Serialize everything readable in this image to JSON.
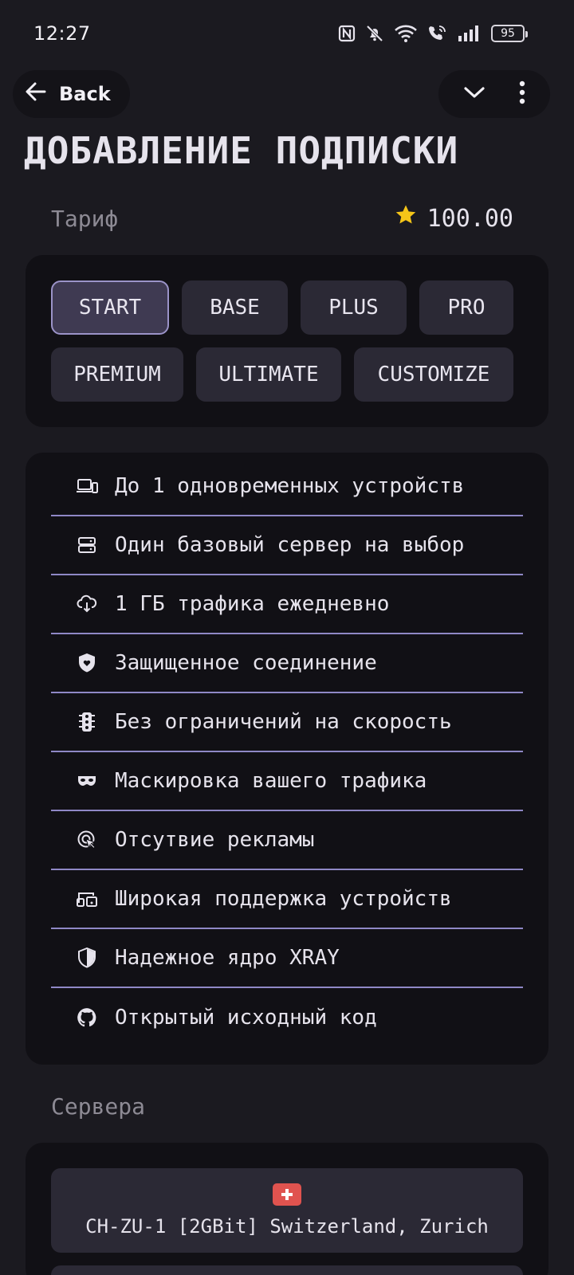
{
  "status_bar": {
    "time": "12:27",
    "battery": "95"
  },
  "header": {
    "back_label": "Back"
  },
  "page": {
    "title": "ДОБАВЛЕНИЕ ПОДПИСКИ"
  },
  "tariff": {
    "label": "Тариф",
    "price": "100.00"
  },
  "plans": {
    "row1": [
      {
        "label": "START",
        "selected": true
      },
      {
        "label": "BASE"
      },
      {
        "label": "PLUS"
      },
      {
        "label": "PRO"
      }
    ],
    "row2": [
      {
        "label": "PREMIUM"
      },
      {
        "label": "ULTIMATE"
      },
      {
        "label": "CUSTOMIZE"
      }
    ]
  },
  "features": [
    {
      "icon": "devices-icon",
      "text": "До 1 одновременных устройств"
    },
    {
      "icon": "server-icon",
      "text": "Один базовый сервер на выбор"
    },
    {
      "icon": "cloud-download-icon",
      "text": "1 ГБ трафика ежедневно"
    },
    {
      "icon": "shield-heart-icon",
      "text": "Защищенное соединение"
    },
    {
      "icon": "traffic-light-icon",
      "text": "Без ограничений на скорость"
    },
    {
      "icon": "mask-icon",
      "text": "Маскировка вашего трафика"
    },
    {
      "icon": "ad-block-icon",
      "text": "Отсутвие рекламы"
    },
    {
      "icon": "multi-device-icon",
      "text": "Широкая поддержка устройств"
    },
    {
      "icon": "shield-half-icon",
      "text": "Надежное ядро XRAY"
    },
    {
      "icon": "github-icon",
      "text": "Открытый исходный код"
    }
  ],
  "servers": {
    "label": "Сервера",
    "items": [
      {
        "flag_icon": "switzerland-flag-icon",
        "name": "CH-ZU-1 [2GBit] Switzerland, Zurich"
      }
    ]
  },
  "colors": {
    "background": "#1b1a20",
    "card": "#111015",
    "button": "#2b2935",
    "accent": "#9b93c8",
    "divider": "#8f88c6",
    "flag_red": "#e0534f",
    "star": "#f5c518"
  }
}
